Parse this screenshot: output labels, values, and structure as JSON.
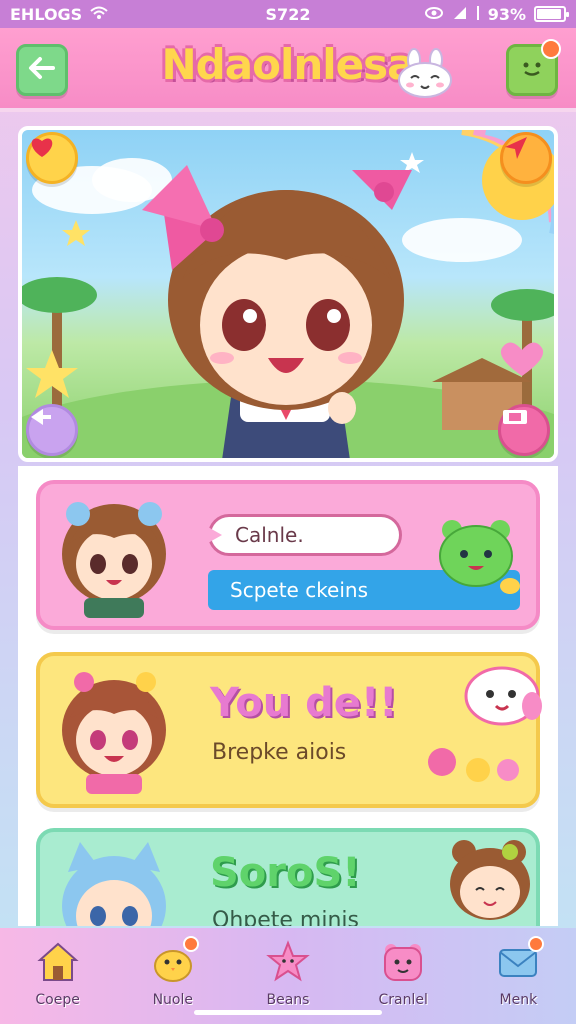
{
  "status_bar": {
    "carrier": "EHLOGS",
    "time": "S722",
    "battery": "93%",
    "battery_level": 0.93
  },
  "header": {
    "title": "Ndaolnlesa"
  },
  "card1": {
    "speech_text": "Calnle.",
    "blue_text": "Scpete ckeins"
  },
  "card2": {
    "title": "You de!!",
    "subtitle": "Brepke aiois"
  },
  "card3": {
    "title": "SoroS!",
    "subtitle": "Ohpete minis"
  },
  "bottom_nav": {
    "items": [
      {
        "label": "Coepe",
        "icon": "house-icon"
      },
      {
        "label": "Nuole",
        "icon": "chick-icon"
      },
      {
        "label": "Beans",
        "icon": "star-icon"
      },
      {
        "label": "Cranlel",
        "icon": "bear-icon"
      },
      {
        "label": "Menk",
        "icon": "mail-icon"
      }
    ]
  },
  "colors": {
    "header_pink": "#f78cc6",
    "title_yellow": "#ffd64d",
    "card_pink": "#fbaad9",
    "card_yellow": "#fde67e",
    "card_mint": "#a9ecd0",
    "accent_blue": "#33a4e8"
  }
}
